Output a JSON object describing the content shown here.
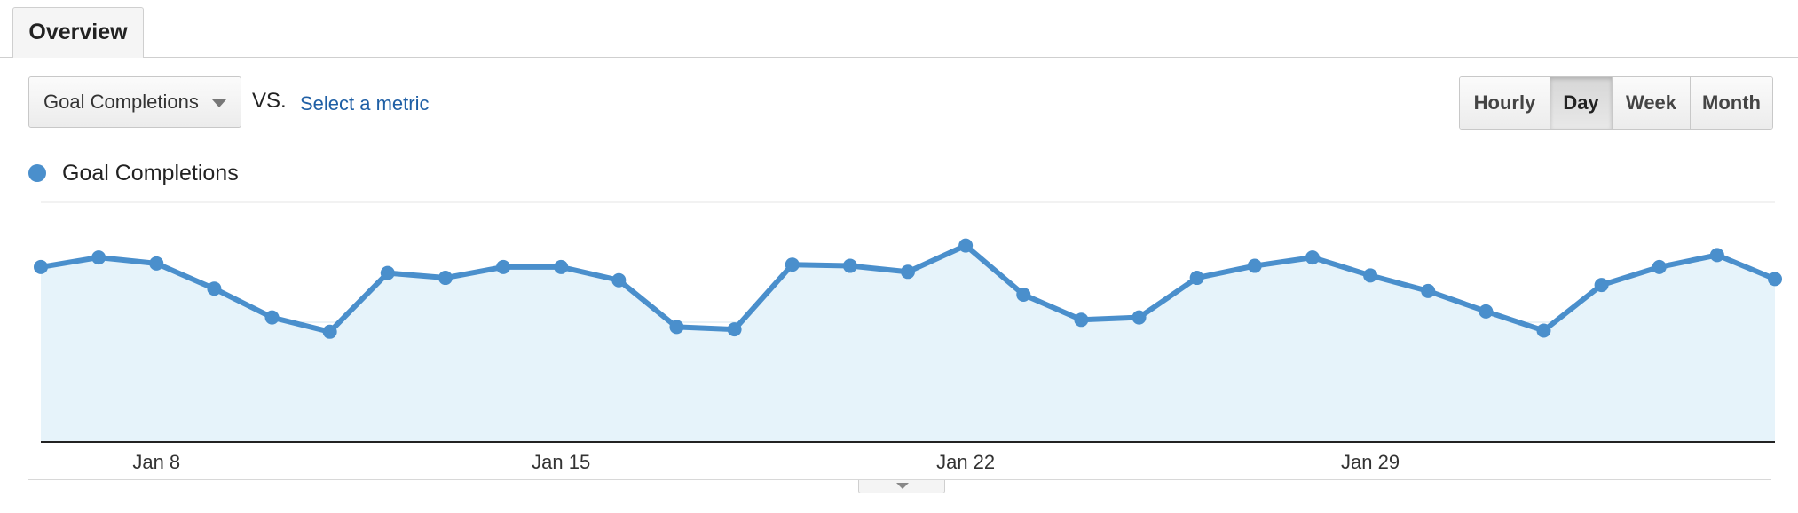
{
  "tabs": [
    {
      "label": "Overview",
      "active": true
    }
  ],
  "metric_selector": {
    "selected": "Goal Completions"
  },
  "compare": {
    "vs_label": "VS.",
    "link_label": "Select a metric"
  },
  "period_buttons": [
    {
      "label": "Hourly",
      "active": false
    },
    {
      "label": "Day",
      "active": true
    },
    {
      "label": "Week",
      "active": false
    },
    {
      "label": "Month",
      "active": false
    }
  ],
  "legend": {
    "label": "Goal Completions",
    "color": "#4a8fcc"
  },
  "colors": {
    "line": "#4a8fcc",
    "area": "#e6f3fa",
    "grid": "#d4e6ef",
    "axis": "#222222",
    "link": "#1f5fa5"
  },
  "icons": {
    "dropdown": "chevron-down-icon",
    "expand": "chevron-down-icon"
  },
  "chart_data": {
    "type": "area",
    "x": [
      "Jan 6",
      "Jan 7",
      "Jan 8",
      "Jan 9",
      "Jan 10",
      "Jan 11",
      "Jan 12",
      "Jan 13",
      "Jan 14",
      "Jan 15",
      "Jan 16",
      "Jan 17",
      "Jan 18",
      "Jan 19",
      "Jan 20",
      "Jan 21",
      "Jan 22",
      "Jan 23",
      "Jan 24",
      "Jan 25",
      "Jan 26",
      "Jan 27",
      "Jan 28",
      "Jan 29",
      "Jan 30",
      "Jan 31",
      "Feb 1",
      "Feb 2",
      "Feb 3",
      "Feb 4",
      "Feb 5",
      "Feb 6",
      "Feb 7"
    ],
    "series": [
      {
        "name": "Goal Completions",
        "values": [
          73,
          77,
          74.5,
          64,
          52,
          46,
          70.5,
          68.5,
          73,
          73,
          67.5,
          48,
          47,
          74,
          73.5,
          71,
          82,
          61.5,
          51,
          52,
          68.5,
          73.5,
          77,
          69.5,
          63,
          54.5,
          46.5,
          65.5,
          73,
          78,
          68
        ]
      }
    ],
    "x_ticks": [
      {
        "label": "Jan 8",
        "index": 2
      },
      {
        "label": "Jan 15",
        "index": 9
      },
      {
        "label": "Jan 22",
        "index": 16
      },
      {
        "label": "Jan 29",
        "index": 23
      }
    ],
    "ylim": [
      0,
      100
    ],
    "grid": true,
    "legend_position": "top-left"
  }
}
